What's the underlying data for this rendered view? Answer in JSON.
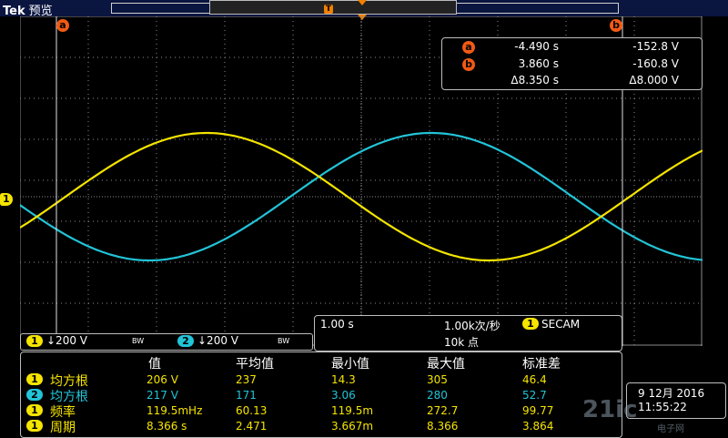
{
  "header": {
    "brand": "Tek",
    "mode": "预览",
    "trigger_pos_label": "T"
  },
  "channel_marker": {
    "label": "1",
    "color": "#f5e400"
  },
  "cursors": {
    "a_label": "a",
    "b_label": "b",
    "readout": {
      "a": {
        "tag": "a",
        "time": "-4.490 s",
        "volt": "-152.8 V"
      },
      "b": {
        "tag": "b",
        "time": "3.860 s",
        "volt": "-160.8 V"
      },
      "delta": {
        "time": "Δ8.350 s",
        "volt": "Δ8.000 V"
      }
    }
  },
  "channels": [
    {
      "num": "1",
      "scale": "↓200 V",
      "bw": "BW",
      "color": "#f5e400"
    },
    {
      "num": "2",
      "scale": "↓200 V",
      "bw": "BW",
      "color": "#22c4d8"
    }
  ],
  "horizontal": {
    "time_div": "1.00 s",
    "rate": "1.00k次/秒",
    "trigger_src": "1",
    "trigger_type": "SECAM",
    "record": "10k 点"
  },
  "measurements": {
    "headers": [
      "值",
      "平均值",
      "最小值",
      "最大值",
      "标准差"
    ],
    "rows": [
      {
        "ch": "1",
        "color": "#f5e400",
        "name": "均方根",
        "value": "206 V",
        "mean": "237",
        "min": "14.3",
        "max": "305",
        "std": "46.4"
      },
      {
        "ch": "2",
        "color": "#22c4d8",
        "name": "均方根",
        "value": "217 V",
        "mean": "171",
        "min": "3.06",
        "max": "280",
        "std": "52.7"
      },
      {
        "ch": "1",
        "color": "#f5e400",
        "name": "频率",
        "value": "119.5mHz",
        "mean": "60.13",
        "min": "119.5m",
        "max": "272.7",
        "std": "99.77"
      },
      {
        "ch": "1",
        "color": "#f5e400",
        "name": "周期",
        "value": "8.366 s",
        "mean": "2.471",
        "min": "3.667m",
        "max": "8.366",
        "std": "3.864"
      }
    ]
  },
  "datetime": {
    "date": "9 12月  2016",
    "time": "11:55:22"
  },
  "watermark": {
    "main": "21ic",
    "sub": "电子网"
  },
  "colors": {
    "ch1": "#f5e400",
    "ch2": "#22c4d8",
    "cursor": "#f05a14",
    "grid": "#8a8a8a"
  }
}
